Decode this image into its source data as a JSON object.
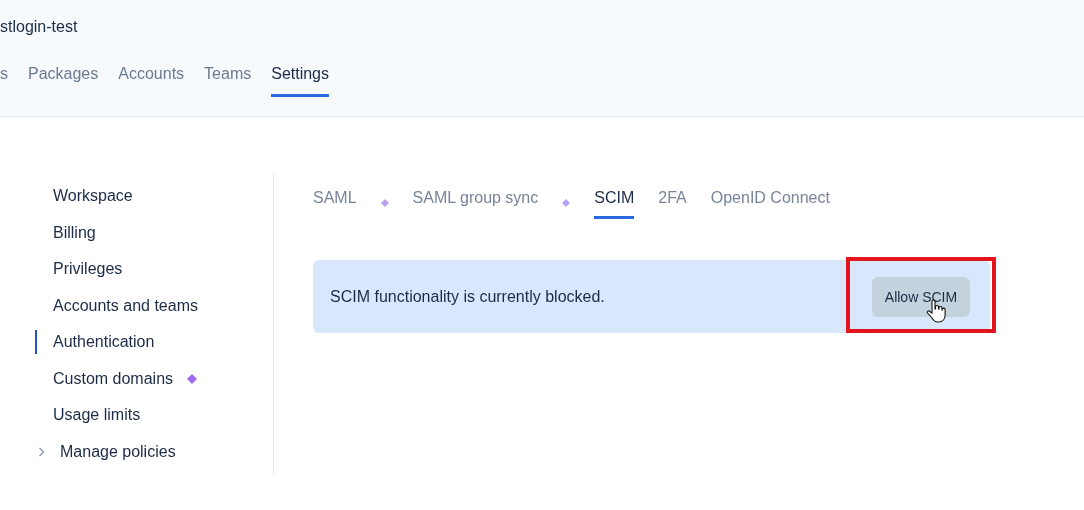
{
  "header": {
    "title": "stlogin-test"
  },
  "nav": [
    {
      "label": "s",
      "selected": false
    },
    {
      "label": "Packages",
      "selected": false
    },
    {
      "label": "Accounts",
      "selected": false
    },
    {
      "label": "Teams",
      "selected": false
    },
    {
      "label": "Settings",
      "selected": true
    }
  ],
  "sidebar": {
    "items": [
      {
        "label": "Workspace",
        "selected": false,
        "premium": false
      },
      {
        "label": "Billing",
        "selected": false,
        "premium": false
      },
      {
        "label": "Privileges",
        "selected": false,
        "premium": false
      },
      {
        "label": "Accounts and teams",
        "selected": false,
        "premium": false
      },
      {
        "label": "Authentication",
        "selected": true,
        "premium": false
      },
      {
        "label": "Custom domains",
        "selected": false,
        "premium": true
      },
      {
        "label": "Usage limits",
        "selected": false,
        "premium": false
      },
      {
        "label": "Manage policies",
        "selected": false,
        "premium": false,
        "expanded": false
      }
    ]
  },
  "tabs": [
    {
      "label": "SAML",
      "selected": false,
      "premium": true
    },
    {
      "label": "SAML group sync",
      "selected": false,
      "premium": true
    },
    {
      "label": "SCIM",
      "selected": true,
      "premium": false
    },
    {
      "label": "2FA",
      "selected": false,
      "premium": false
    },
    {
      "label": "OpenID Connect",
      "selected": false,
      "premium": false
    }
  ],
  "banner": {
    "message": "SCIM functionality is currently blocked.",
    "button": {
      "label": "Allow SCIM",
      "highlighted": true,
      "hovered": true
    }
  }
}
